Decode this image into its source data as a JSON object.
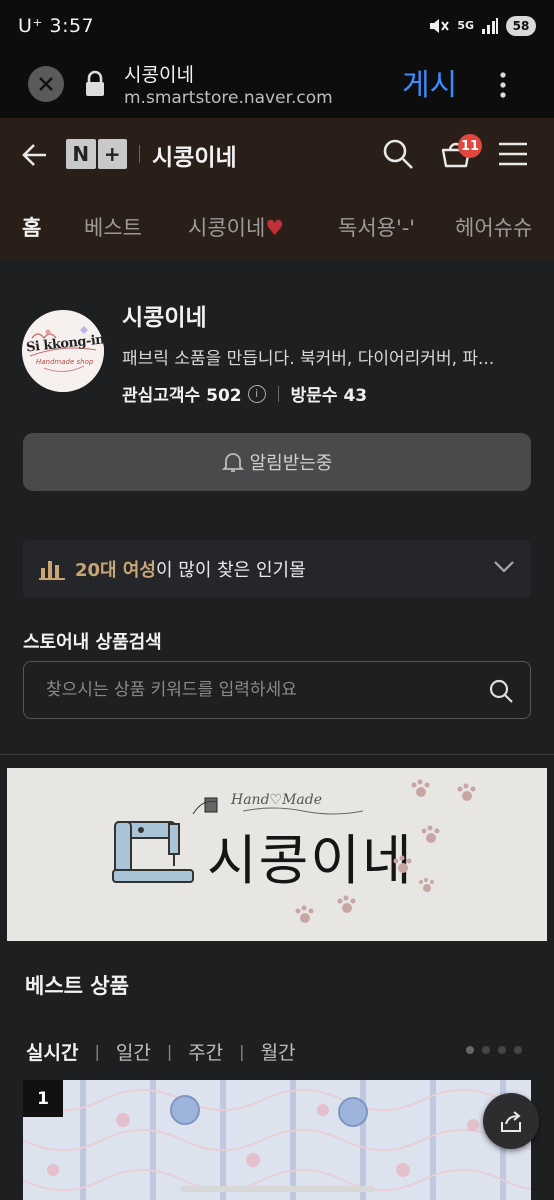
{
  "status_bar": {
    "carrier_time": "U⁺ 3:57",
    "network": "5G",
    "battery": "58"
  },
  "browser": {
    "title": "시콩이네",
    "url": "m.smartstore.naver.com",
    "post_label": "게시"
  },
  "header": {
    "logo_left": "N",
    "logo_right": "+",
    "store_name": "시콩이네",
    "cart_count": "11"
  },
  "nav_tabs": [
    {
      "label": "홈"
    },
    {
      "label": "베스트"
    },
    {
      "label": "시콩이네"
    },
    {
      "label": "독서용'-'"
    },
    {
      "label": "헤어슈슈"
    }
  ],
  "profile": {
    "name": "시콩이네",
    "description": "패브릭 소품을 만듭니다. 북커버, 다이어리커버, 파...",
    "followers_label": "관심고객수 502",
    "visitors_label": "방문수 43",
    "avatar_text_main": "Si kkong-ine",
    "avatar_text_sub": "Handmade shop",
    "notify_label": "알림받는중"
  },
  "popular": {
    "highlight": "20대 여성",
    "rest": "이 많이 찾은 인기몰"
  },
  "search": {
    "title": "스토어내 상품검색",
    "placeholder": "찾으시는 상품 키워드를 입력하세요"
  },
  "banner": {
    "title": "시콩이네",
    "subtitle": "Hand♡Made"
  },
  "best": {
    "title": "베스트 상품",
    "periods": [
      {
        "label": "실시간"
      },
      {
        "label": "일간"
      },
      {
        "label": "주간"
      },
      {
        "label": "월간"
      }
    ],
    "active_period": "실시간",
    "rank": "1"
  },
  "colors": {
    "accent_blue": "#3d8bff",
    "badge_red": "#e0483f",
    "highlight_gold": "#c8a675",
    "header_bg": "#2a1e18"
  }
}
